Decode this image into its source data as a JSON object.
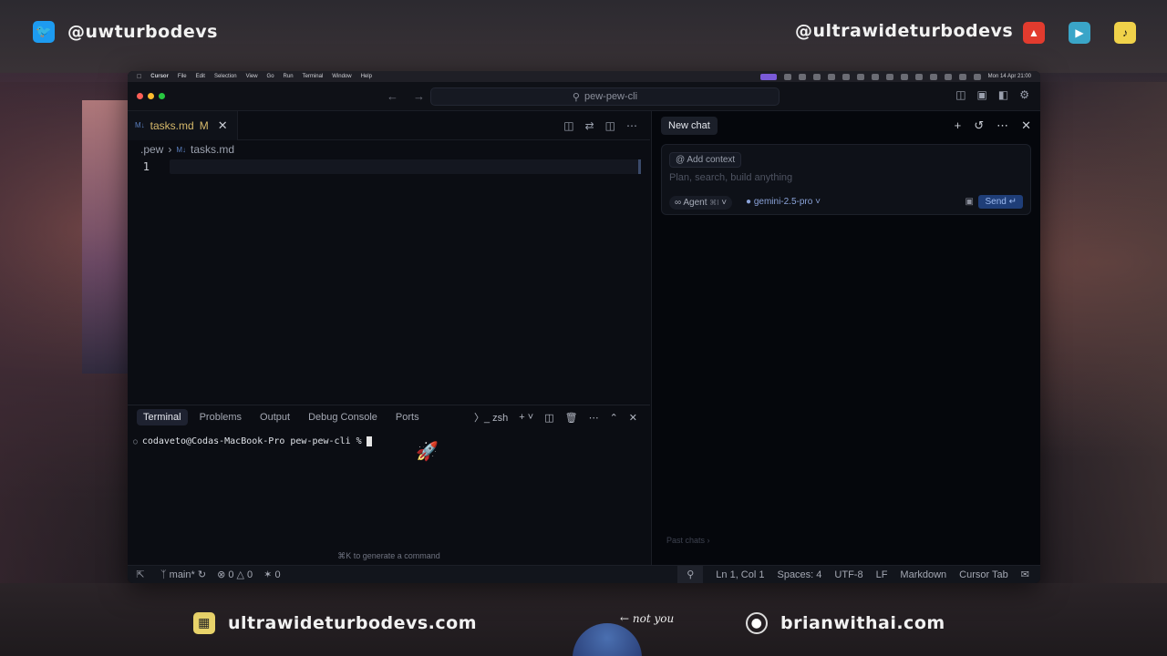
{
  "overlay": {
    "twitter_handle": "@uwturbodevs",
    "youtube_handle": "@ultrawideturbodevs",
    "site_left": "ultrawideturbodevs.com",
    "site_right": "brianwithai.com",
    "caption": "not you",
    "icons": {
      "twitter": "twitter-icon",
      "red_app": "red-app-icon",
      "youtube": "youtube-icon",
      "tiktok": "tiktok-icon"
    }
  },
  "menubar": {
    "app": "Cursor",
    "items": [
      "File",
      "Edit",
      "Selection",
      "View",
      "Go",
      "Run",
      "Terminal",
      "Window",
      "Help"
    ],
    "clock": "Mon 14 Apr 21:00"
  },
  "titlebar": {
    "search": "pew-pew-cli"
  },
  "editor": {
    "tab": {
      "label": "tasks.md",
      "modified": "M"
    },
    "breadcrumb": {
      "folder": ".pew",
      "file": "tasks.md"
    },
    "line_number": "1"
  },
  "panel": {
    "tabs": [
      "Terminal",
      "Problems",
      "Output",
      "Debug Console",
      "Ports"
    ],
    "shell": "zsh",
    "prompt": "codaveto@Codas-MacBook-Pro pew-pew-cli %",
    "hint": "⌘K to generate a command"
  },
  "chat": {
    "title": "New chat",
    "add_context": "Add context",
    "placeholder": "Plan, search, build anything",
    "mode": "Agent",
    "mode_shortcut": "⌘I",
    "model": "gemini-2.5-pro",
    "send": "Send",
    "past_chats": "Past chats"
  },
  "statusbar": {
    "branch": "main*",
    "errors": "0",
    "warnings": "0",
    "ports": "0",
    "position": "Ln 1, Col 1",
    "spaces": "Spaces: 4",
    "encoding": "UTF-8",
    "eol": "LF",
    "language": "Markdown",
    "cursor_tab": "Cursor Tab"
  },
  "colors": {
    "accent": "#1f3e78",
    "tab_modified": "#d6b96a"
  }
}
